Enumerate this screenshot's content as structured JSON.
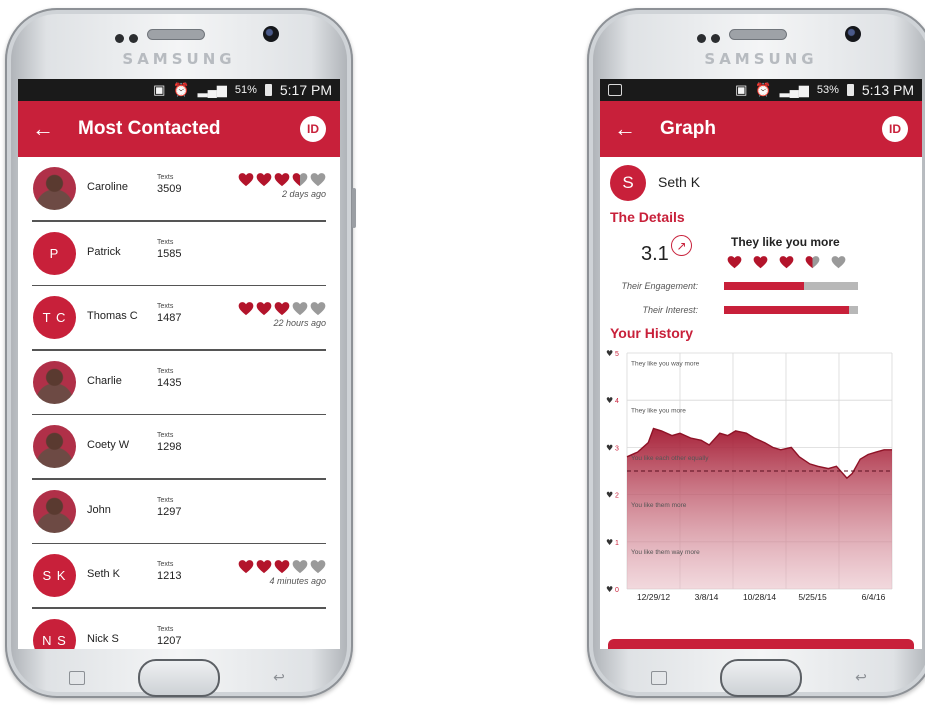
{
  "phones": {
    "brand": "SAMSUNG"
  },
  "left_screen": {
    "status": {
      "pct": "51%",
      "time": "5:17 PM"
    },
    "appbar": {
      "back": "←",
      "title": "Most Contacted",
      "badge": "ID"
    },
    "texts_label": "Texts",
    "contacts": [
      {
        "name": "Caroline",
        "texts": "3509",
        "avatar": "photo",
        "initials": "",
        "hearts": [
          1,
          1,
          1,
          0.5,
          0
        ],
        "ago": "2 days ago"
      },
      {
        "name": "Patrick",
        "texts": "1585",
        "avatar": "initials",
        "initials": "P",
        "hearts": [],
        "ago": ""
      },
      {
        "name": "Thomas C",
        "texts": "1487",
        "avatar": "initials",
        "initials": "T C",
        "hearts": [
          1,
          1,
          1,
          0,
          0
        ],
        "ago": "22 hours ago"
      },
      {
        "name": "Charlie",
        "texts": "1435",
        "avatar": "photo",
        "initials": "",
        "hearts": [],
        "ago": ""
      },
      {
        "name": "Coety W",
        "texts": "1298",
        "avatar": "photo",
        "initials": "",
        "hearts": [],
        "ago": ""
      },
      {
        "name": "John",
        "texts": "1297",
        "avatar": "photo",
        "initials": "",
        "hearts": [],
        "ago": ""
      },
      {
        "name": "Seth K",
        "texts": "1213",
        "avatar": "initials",
        "initials": "S K",
        "hearts": [
          1,
          1,
          1,
          0,
          0
        ],
        "ago": "4 minutes ago"
      },
      {
        "name": "Nick S",
        "texts": "1207",
        "avatar": "initials",
        "initials": "N S",
        "hearts": [],
        "ago": ""
      }
    ]
  },
  "right_screen": {
    "status": {
      "pct": "53%",
      "time": "5:13 PM"
    },
    "appbar": {
      "back": "←",
      "title": "Graph",
      "badge": "ID"
    },
    "person": {
      "initial": "S",
      "name": "Seth K"
    },
    "details_title": "The Details",
    "score": "3.1",
    "verdict": "They like you more",
    "verdict_hearts": [
      1,
      1,
      1,
      0.5,
      0
    ],
    "metrics": [
      {
        "label": "Their Engagement:",
        "value": 0.6
      },
      {
        "label": "Their Interest:",
        "value": 0.93
      }
    ],
    "history_title": "Your History"
  },
  "colors": {
    "brand_red": "#c8203a",
    "heart_red": "#b3142b",
    "heart_gray": "#9a9a9a",
    "status_bar": "#1a1a1a"
  },
  "chart_data": {
    "type": "area",
    "xlabel": "",
    "ylabel": "",
    "ylim": [
      0,
      5
    ],
    "y_ticks": [
      "0",
      "1",
      "2",
      "3",
      "4",
      "5"
    ],
    "x_ticks": [
      "12/29/12",
      "3/8/14",
      "10/28/14",
      "5/25/15",
      "6/4/16"
    ],
    "band_labels": [
      {
        "y": 4.8,
        "text": "They like you way more"
      },
      {
        "y": 3.8,
        "text": "They like you more"
      },
      {
        "y": 2.8,
        "text": "You like each other equally"
      },
      {
        "y": 1.8,
        "text": "You like them more"
      },
      {
        "y": 0.8,
        "text": "You like them way more"
      }
    ],
    "reference_line": 2.5,
    "series": [
      {
        "x": [
          0,
          0.04,
          0.08,
          0.1,
          0.13,
          0.17,
          0.2,
          0.24,
          0.28,
          0.31,
          0.35,
          0.38,
          0.41,
          0.45,
          0.48,
          0.52,
          0.55,
          0.58,
          0.62,
          0.65,
          0.69,
          0.72,
          0.76,
          0.79,
          0.83,
          0.85,
          0.88,
          0.91,
          0.94,
          0.97,
          1.0
        ],
        "values": [
          2.8,
          2.9,
          3.1,
          3.4,
          3.35,
          3.25,
          3.3,
          3.2,
          3.15,
          3.05,
          3.3,
          3.25,
          3.35,
          3.3,
          3.2,
          3.1,
          3.0,
          2.95,
          3.0,
          2.8,
          2.65,
          2.6,
          2.55,
          2.6,
          2.35,
          2.45,
          2.75,
          2.85,
          2.9,
          2.95,
          2.95
        ]
      }
    ]
  }
}
